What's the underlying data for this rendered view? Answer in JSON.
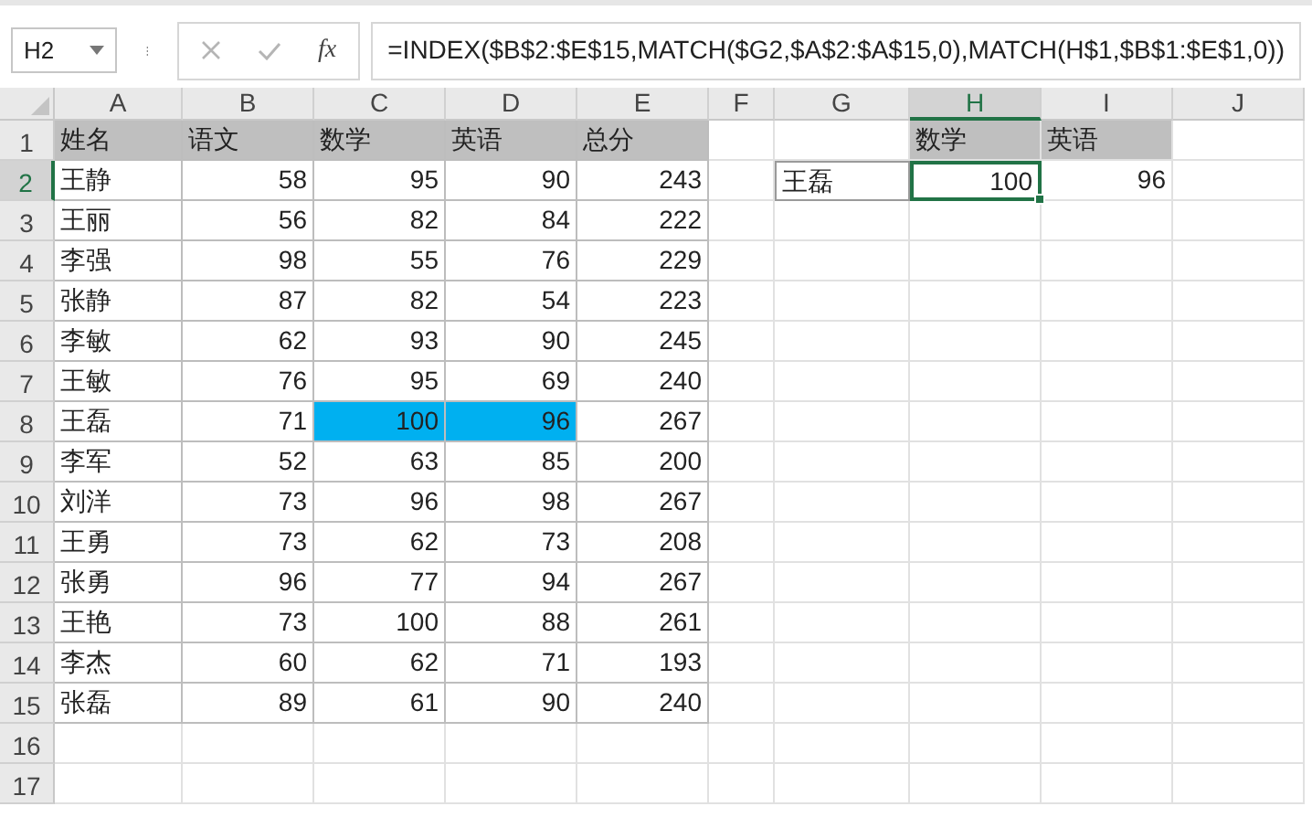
{
  "name_box": {
    "value": "H2"
  },
  "formula_bar": {
    "fx_label": "fx",
    "formula": "=INDEX($B$2:$E$15,MATCH($G2,$A$2:$A$15,0),MATCH(H$1,$B$1:$E$1,0))"
  },
  "columns": [
    {
      "label": "A",
      "selected": false
    },
    {
      "label": "B",
      "selected": false
    },
    {
      "label": "C",
      "selected": false
    },
    {
      "label": "D",
      "selected": false
    },
    {
      "label": "E",
      "selected": false
    },
    {
      "label": "F",
      "selected": false
    },
    {
      "label": "G",
      "selected": false
    },
    {
      "label": "H",
      "selected": true
    },
    {
      "label": "I",
      "selected": false
    },
    {
      "label": "J",
      "selected": false
    }
  ],
  "row_numbers": [
    {
      "label": "1",
      "selected": false
    },
    {
      "label": "2",
      "selected": true
    },
    {
      "label": "3",
      "selected": false
    },
    {
      "label": "4",
      "selected": false
    },
    {
      "label": "5",
      "selected": false
    },
    {
      "label": "6",
      "selected": false
    },
    {
      "label": "7",
      "selected": false
    },
    {
      "label": "8",
      "selected": false
    },
    {
      "label": "9",
      "selected": false
    },
    {
      "label": "10",
      "selected": false
    },
    {
      "label": "11",
      "selected": false
    },
    {
      "label": "12",
      "selected": false
    },
    {
      "label": "13",
      "selected": false
    },
    {
      "label": "14",
      "selected": false
    },
    {
      "label": "15",
      "selected": false
    },
    {
      "label": "16",
      "selected": false
    },
    {
      "label": "17",
      "selected": false
    }
  ],
  "table": {
    "header": [
      "姓名",
      "语文",
      "数学",
      "英语",
      "总分"
    ],
    "rows": [
      {
        "cells": [
          {
            "text": "王静",
            "highlighted": false
          },
          {
            "text": "58",
            "highlighted": false
          },
          {
            "text": "95",
            "highlighted": false
          },
          {
            "text": "90",
            "highlighted": false
          },
          {
            "text": "243",
            "highlighted": false
          }
        ]
      },
      {
        "cells": [
          {
            "text": "王丽",
            "highlighted": false
          },
          {
            "text": "56",
            "highlighted": false
          },
          {
            "text": "82",
            "highlighted": false
          },
          {
            "text": "84",
            "highlighted": false
          },
          {
            "text": "222",
            "highlighted": false
          }
        ]
      },
      {
        "cells": [
          {
            "text": "李强",
            "highlighted": false
          },
          {
            "text": "98",
            "highlighted": false
          },
          {
            "text": "55",
            "highlighted": false
          },
          {
            "text": "76",
            "highlighted": false
          },
          {
            "text": "229",
            "highlighted": false
          }
        ]
      },
      {
        "cells": [
          {
            "text": "张静",
            "highlighted": false
          },
          {
            "text": "87",
            "highlighted": false
          },
          {
            "text": "82",
            "highlighted": false
          },
          {
            "text": "54",
            "highlighted": false
          },
          {
            "text": "223",
            "highlighted": false
          }
        ]
      },
      {
        "cells": [
          {
            "text": "李敏",
            "highlighted": false
          },
          {
            "text": "62",
            "highlighted": false
          },
          {
            "text": "93",
            "highlighted": false
          },
          {
            "text": "90",
            "highlighted": false
          },
          {
            "text": "245",
            "highlighted": false
          }
        ]
      },
      {
        "cells": [
          {
            "text": "王敏",
            "highlighted": false
          },
          {
            "text": "76",
            "highlighted": false
          },
          {
            "text": "95",
            "highlighted": false
          },
          {
            "text": "69",
            "highlighted": false
          },
          {
            "text": "240",
            "highlighted": false
          }
        ]
      },
      {
        "cells": [
          {
            "text": "王磊",
            "highlighted": false
          },
          {
            "text": "71",
            "highlighted": false
          },
          {
            "text": "100",
            "highlighted": true
          },
          {
            "text": "96",
            "highlighted": true
          },
          {
            "text": "267",
            "highlighted": false
          }
        ]
      },
      {
        "cells": [
          {
            "text": "李军",
            "highlighted": false
          },
          {
            "text": "52",
            "highlighted": false
          },
          {
            "text": "63",
            "highlighted": false
          },
          {
            "text": "85",
            "highlighted": false
          },
          {
            "text": "200",
            "highlighted": false
          }
        ]
      },
      {
        "cells": [
          {
            "text": "刘洋",
            "highlighted": false
          },
          {
            "text": "73",
            "highlighted": false
          },
          {
            "text": "96",
            "highlighted": false
          },
          {
            "text": "98",
            "highlighted": false
          },
          {
            "text": "267",
            "highlighted": false
          }
        ]
      },
      {
        "cells": [
          {
            "text": "王勇",
            "highlighted": false
          },
          {
            "text": "73",
            "highlighted": false
          },
          {
            "text": "62",
            "highlighted": false
          },
          {
            "text": "73",
            "highlighted": false
          },
          {
            "text": "208",
            "highlighted": false
          }
        ]
      },
      {
        "cells": [
          {
            "text": "张勇",
            "highlighted": false
          },
          {
            "text": "96",
            "highlighted": false
          },
          {
            "text": "77",
            "highlighted": false
          },
          {
            "text": "94",
            "highlighted": false
          },
          {
            "text": "267",
            "highlighted": false
          }
        ]
      },
      {
        "cells": [
          {
            "text": "王艳",
            "highlighted": false
          },
          {
            "text": "73",
            "highlighted": false
          },
          {
            "text": "100",
            "highlighted": false
          },
          {
            "text": "88",
            "highlighted": false
          },
          {
            "text": "261",
            "highlighted": false
          }
        ]
      },
      {
        "cells": [
          {
            "text": "李杰",
            "highlighted": false
          },
          {
            "text": "60",
            "highlighted": false
          },
          {
            "text": "62",
            "highlighted": false
          },
          {
            "text": "71",
            "highlighted": false
          },
          {
            "text": "193",
            "highlighted": false
          }
        ]
      },
      {
        "cells": [
          {
            "text": "张磊",
            "highlighted": false
          },
          {
            "text": "89",
            "highlighted": false
          },
          {
            "text": "61",
            "highlighted": false
          },
          {
            "text": "90",
            "highlighted": false
          },
          {
            "text": "240",
            "highlighted": false
          }
        ]
      }
    ]
  },
  "lookup": {
    "headers": [
      "数学",
      "英语"
    ],
    "label": "王磊",
    "values": [
      {
        "text": "100",
        "selected": true
      },
      {
        "text": "96",
        "selected": false
      }
    ]
  }
}
